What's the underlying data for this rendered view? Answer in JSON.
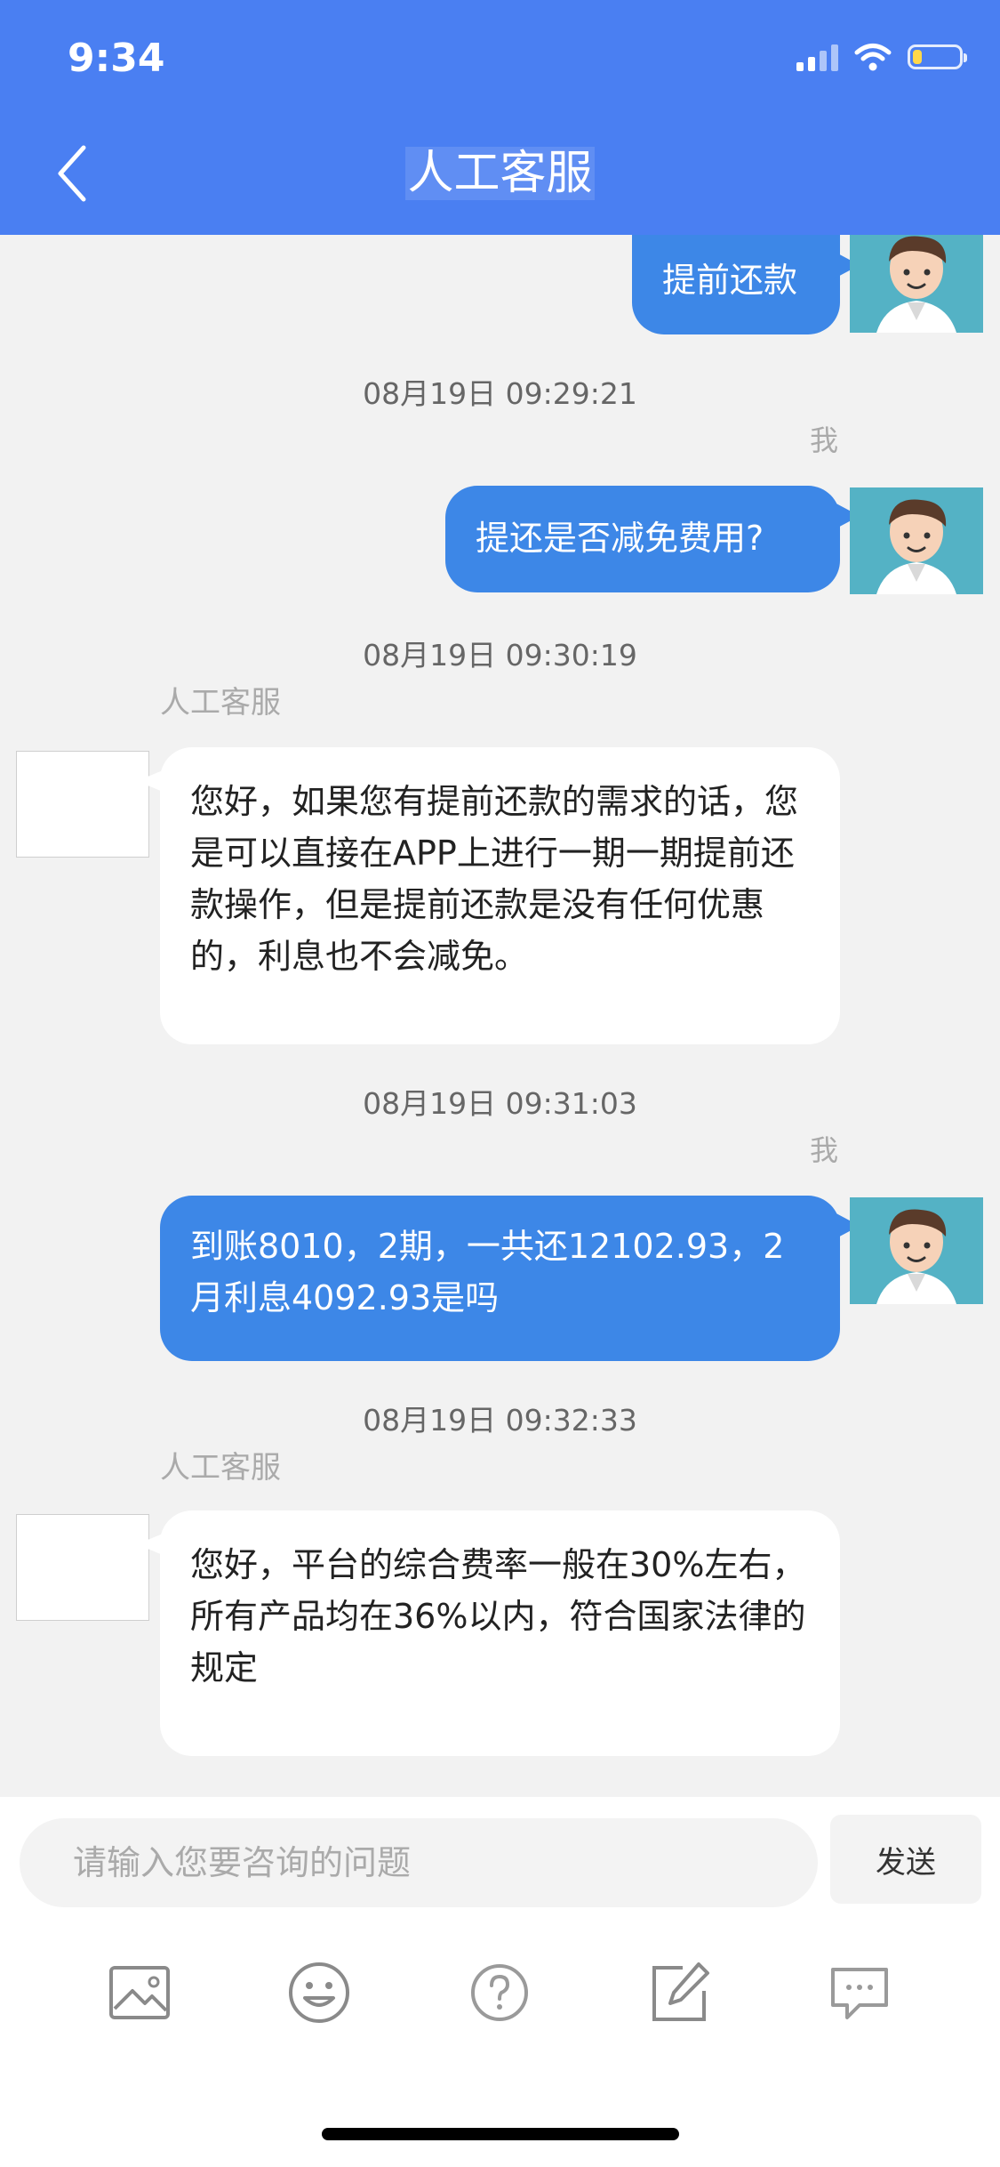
{
  "status_bar": {
    "time": "9:34",
    "battery_level": 0.2
  },
  "header": {
    "title": "人工客服",
    "back_icon": "chevron-left-icon"
  },
  "messages": [
    {
      "sender": "me",
      "text": "提前还款"
    },
    {
      "timestamp": "08月19日 09:29:21",
      "sender_label": "我",
      "sender": "me",
      "text": "提还是否减免费用?"
    },
    {
      "timestamp": "08月19日 09:30:19",
      "sender_label": "人工客服",
      "sender": "agent",
      "text": "您好，如果您有提前还款的需求的话，您是可以直接在APP上进行一期一期提前还款操作，但是提前还款是没有任何优惠的，利息也不会减免。"
    },
    {
      "timestamp": "08月19日 09:31:03",
      "sender_label": "我",
      "sender": "me",
      "text": "到账8010，2期，一共还12102.93，2月利息4092.93是吗"
    },
    {
      "timestamp": "08月19日 09:32:33",
      "sender_label": "人工客服",
      "sender": "agent",
      "text": "您好，平台的综合费率一般在30%左右，所有产品均在36%以内，符合国家法律的规定"
    }
  ],
  "input": {
    "placeholder": "请输入您要咨询的问题",
    "value": "",
    "send_label": "发送"
  },
  "toolbar": [
    "image-icon",
    "emoji-icon",
    "help-icon",
    "edit-icon",
    "message-icon"
  ],
  "colors": {
    "header": "#4a7ff2",
    "outgoing_bubble": "#3d87e7",
    "incoming_bubble": "#ffffff",
    "background": "#f2f2f2"
  }
}
